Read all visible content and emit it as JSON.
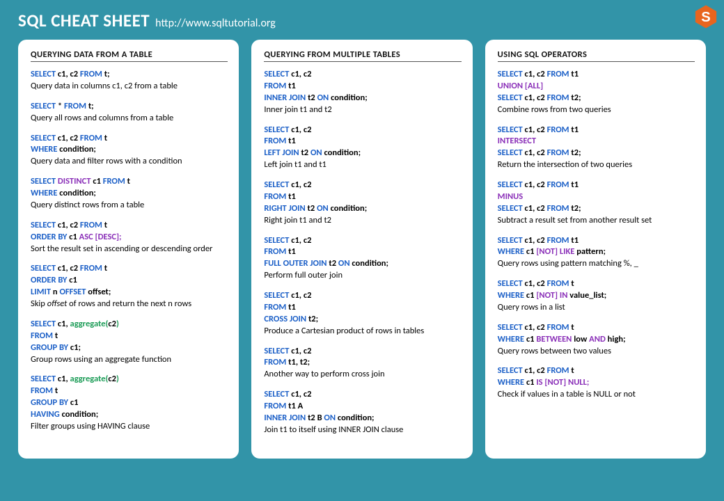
{
  "header": {
    "title": "SQL CHEAT SHEET",
    "url": "http://www.sqltutorial.org"
  },
  "columns": [
    {
      "title": "QUERYING DATA FROM A TABLE",
      "blocks": [
        {
          "code": [
            [
              "b",
              "SELECT"
            ],
            [
              "t",
              " c1, c2 "
            ],
            [
              "b",
              "FROM"
            ],
            [
              "t",
              " t;"
            ]
          ],
          "desc": "Query data in columns c1, c2 from a table"
        },
        {
          "code": [
            [
              "b",
              "SELECT"
            ],
            [
              "t",
              " * "
            ],
            [
              "b",
              "FROM"
            ],
            [
              "t",
              " t;"
            ]
          ],
          "desc": "Query all rows and columns from a table"
        },
        {
          "code": [
            [
              "b",
              "SELECT"
            ],
            [
              "t",
              " c1, c2 "
            ],
            [
              "b",
              "FROM"
            ],
            [
              "t",
              " t"
            ],
            [
              "nl"
            ],
            [
              "b",
              "WHERE"
            ],
            [
              "t",
              " condition;"
            ]
          ],
          "desc": "Query data and filter rows with a condition"
        },
        {
          "code": [
            [
              "b",
              "SELECT"
            ],
            [
              "p",
              " DISTINCT"
            ],
            [
              "t",
              " c1 "
            ],
            [
              "b",
              "FROM"
            ],
            [
              "t",
              " t"
            ],
            [
              "nl"
            ],
            [
              "b",
              "WHERE"
            ],
            [
              "t",
              " condition;"
            ]
          ],
          "desc": "Query distinct rows from a table"
        },
        {
          "code": [
            [
              "b",
              "SELECT"
            ],
            [
              "t",
              " c1, c2 "
            ],
            [
              "b",
              "FROM"
            ],
            [
              "t",
              " t"
            ],
            [
              "nl"
            ],
            [
              "b",
              "ORDER BY"
            ],
            [
              "t",
              " c1 "
            ],
            [
              "p",
              "ASC [DESC];"
            ]
          ],
          "desc": "Sort the result set in ascending or descending order"
        },
        {
          "code": [
            [
              "b",
              "SELECT"
            ],
            [
              "t",
              " c1, c2 "
            ],
            [
              "b",
              "FROM"
            ],
            [
              "t",
              " t"
            ],
            [
              "nl"
            ],
            [
              "b",
              "ORDER BY"
            ],
            [
              "t",
              " c1"
            ],
            [
              "nl"
            ],
            [
              "b",
              "LIMIT"
            ],
            [
              "t",
              " n "
            ],
            [
              "b",
              "OFFSET"
            ],
            [
              "t",
              " offset;"
            ]
          ],
          "desc_html": "Skip <i>offset</i> of rows and return the next n rows"
        },
        {
          "code": [
            [
              "b",
              "SELECT"
            ],
            [
              "t",
              " c1, "
            ],
            [
              "g",
              "aggregate("
            ],
            [
              "t",
              "c2"
            ],
            [
              "g",
              ")"
            ],
            [
              "nl"
            ],
            [
              "b",
              "FROM"
            ],
            [
              "t",
              " t"
            ],
            [
              "nl"
            ],
            [
              "b",
              "GROUP BY"
            ],
            [
              "t",
              " c1;"
            ]
          ],
          "desc": "Group rows using an aggregate function"
        },
        {
          "code": [
            [
              "b",
              "SELECT"
            ],
            [
              "t",
              " c1, "
            ],
            [
              "g",
              "aggregate("
            ],
            [
              "t",
              "c2"
            ],
            [
              "g",
              ")"
            ],
            [
              "nl"
            ],
            [
              "b",
              "FROM"
            ],
            [
              "t",
              " t"
            ],
            [
              "nl"
            ],
            [
              "b",
              "GROUP BY"
            ],
            [
              "t",
              " c1"
            ],
            [
              "nl"
            ],
            [
              "b",
              "HAVING"
            ],
            [
              "t",
              " condition;"
            ]
          ],
          "desc": "Filter groups using HAVING clause"
        }
      ]
    },
    {
      "title": "QUERYING FROM MULTIPLE TABLES",
      "blocks": [
        {
          "code": [
            [
              "b",
              "SELECT"
            ],
            [
              "t",
              " c1, c2"
            ],
            [
              "nl"
            ],
            [
              "b",
              "FROM"
            ],
            [
              "t",
              " t1"
            ],
            [
              "nl"
            ],
            [
              "b",
              "INNER JOIN"
            ],
            [
              "t",
              " t2 "
            ],
            [
              "b",
              "ON"
            ],
            [
              "t",
              " condition;"
            ]
          ],
          "desc": "Inner join t1 and t2"
        },
        {
          "code": [
            [
              "b",
              "SELECT"
            ],
            [
              "t",
              " c1, c2"
            ],
            [
              "nl"
            ],
            [
              "b",
              "FROM"
            ],
            [
              "t",
              " t1"
            ],
            [
              "nl"
            ],
            [
              "b",
              "LEFT JOIN"
            ],
            [
              "t",
              " t2 "
            ],
            [
              "b",
              "ON"
            ],
            [
              "t",
              " condition;"
            ]
          ],
          "desc": "Left join t1 and t1"
        },
        {
          "code": [
            [
              "b",
              "SELECT"
            ],
            [
              "t",
              " c1, c2"
            ],
            [
              "nl"
            ],
            [
              "b",
              "FROM"
            ],
            [
              "t",
              " t1"
            ],
            [
              "nl"
            ],
            [
              "b",
              "RIGHT JOIN"
            ],
            [
              "t",
              " t2 "
            ],
            [
              "b",
              "ON"
            ],
            [
              "t",
              " condition;"
            ]
          ],
          "desc": "Right join t1 and t2"
        },
        {
          "code": [
            [
              "b",
              "SELECT"
            ],
            [
              "t",
              " c1, c2"
            ],
            [
              "nl"
            ],
            [
              "b",
              "FROM"
            ],
            [
              "t",
              " t1"
            ],
            [
              "nl"
            ],
            [
              "b",
              "FULL OUTER JOIN"
            ],
            [
              "t",
              " t2 "
            ],
            [
              "b",
              "ON"
            ],
            [
              "t",
              " condition;"
            ]
          ],
          "desc": "Perform full outer join"
        },
        {
          "code": [
            [
              "b",
              "SELECT"
            ],
            [
              "t",
              " c1, c2"
            ],
            [
              "nl"
            ],
            [
              "b",
              "FROM"
            ],
            [
              "t",
              " t1"
            ],
            [
              "nl"
            ],
            [
              "b",
              "CROSS JOIN"
            ],
            [
              "t",
              " t2;"
            ]
          ],
          "desc": "Produce a Cartesian product of rows in tables"
        },
        {
          "code": [
            [
              "b",
              "SELECT"
            ],
            [
              "t",
              " c1, c2"
            ],
            [
              "nl"
            ],
            [
              "b",
              "FROM"
            ],
            [
              "t",
              " t1, t2"
            ],
            [
              "t",
              ";"
            ]
          ],
          "desc": "Another way to perform cross join"
        },
        {
          "code": [
            [
              "b",
              "SELECT"
            ],
            [
              "t",
              " c1, c2"
            ],
            [
              "nl"
            ],
            [
              "b",
              "FROM"
            ],
            [
              "t",
              " t1 A"
            ],
            [
              "nl"
            ],
            [
              "b",
              "INNER JOIN"
            ],
            [
              "t",
              " t2 B "
            ],
            [
              "b",
              "ON"
            ],
            [
              "t",
              " condition;"
            ]
          ],
          "desc": "Join t1 to itself using INNER JOIN clause"
        }
      ]
    },
    {
      "title": "USING SQL OPERATORS",
      "blocks": [
        {
          "code": [
            [
              "b",
              "SELECT"
            ],
            [
              "t",
              " c1, c2 "
            ],
            [
              "b",
              "FROM"
            ],
            [
              "t",
              " t1"
            ],
            [
              "nl"
            ],
            [
              "p",
              "UNION [ALL]"
            ],
            [
              "nl"
            ],
            [
              "b",
              "SELECT"
            ],
            [
              "t",
              " c1, c2 "
            ],
            [
              "b",
              "FROM"
            ],
            [
              "t",
              " t2;"
            ]
          ],
          "desc": "Combine rows from two queries"
        },
        {
          "code": [
            [
              "b",
              "SELECT"
            ],
            [
              "t",
              " c1, c2 "
            ],
            [
              "b",
              "FROM"
            ],
            [
              "t",
              " t1"
            ],
            [
              "nl"
            ],
            [
              "p",
              "INTERSECT"
            ],
            [
              "nl"
            ],
            [
              "b",
              "SELECT"
            ],
            [
              "t",
              " c1, c2 "
            ],
            [
              "b",
              "FROM"
            ],
            [
              "t",
              " t2;"
            ]
          ],
          "desc": "Return the intersection of two queries"
        },
        {
          "code": [
            [
              "b",
              "SELECT"
            ],
            [
              "t",
              " c1, c2 "
            ],
            [
              "b",
              "FROM"
            ],
            [
              "t",
              " t1"
            ],
            [
              "nl"
            ],
            [
              "p",
              "MINUS"
            ],
            [
              "nl"
            ],
            [
              "b",
              "SELECT"
            ],
            [
              "t",
              " c1, c2 "
            ],
            [
              "b",
              "FROM"
            ],
            [
              "t",
              " t2;"
            ]
          ],
          "desc": "Subtract a result set from another result set"
        },
        {
          "code": [
            [
              "b",
              "SELECT"
            ],
            [
              "t",
              " c1, c2 "
            ],
            [
              "b",
              "FROM"
            ],
            [
              "t",
              " t1"
            ],
            [
              "nl"
            ],
            [
              "b",
              "WHERE"
            ],
            [
              "t",
              " c1 "
            ],
            [
              "p",
              "[NOT] LIKE"
            ],
            [
              "t",
              " pattern;"
            ]
          ],
          "desc": "Query rows using pattern matching %, _"
        },
        {
          "code": [
            [
              "b",
              "SELECT"
            ],
            [
              "t",
              " c1, c2 "
            ],
            [
              "b",
              "FROM"
            ],
            [
              "t",
              " t"
            ],
            [
              "nl"
            ],
            [
              "b",
              "WHERE"
            ],
            [
              "t",
              " c1 "
            ],
            [
              "p",
              "[NOT] IN"
            ],
            [
              "t",
              " value_list;"
            ]
          ],
          "desc": "Query rows in a list"
        },
        {
          "code": [
            [
              "b",
              "SELECT"
            ],
            [
              "t",
              " c1, c2 "
            ],
            [
              "b",
              "FROM"
            ],
            [
              "t",
              " t"
            ],
            [
              "nl"
            ],
            [
              "b",
              "WHERE "
            ],
            [
              "t",
              " c1 "
            ],
            [
              "p",
              "BETWEEN"
            ],
            [
              "t",
              " low "
            ],
            [
              "p",
              "AND"
            ],
            [
              "t",
              " high;"
            ]
          ],
          "desc": "Query rows between two values"
        },
        {
          "code": [
            [
              "b",
              "SELECT"
            ],
            [
              "t",
              " c1, c2 "
            ],
            [
              "b",
              "FROM"
            ],
            [
              "t",
              " t"
            ],
            [
              "nl"
            ],
            [
              "b",
              "WHERE "
            ],
            [
              "t",
              " c1 "
            ],
            [
              "p",
              "IS [NOT] NULL;"
            ]
          ],
          "desc": "Check if values in a table is NULL or not"
        }
      ]
    }
  ]
}
